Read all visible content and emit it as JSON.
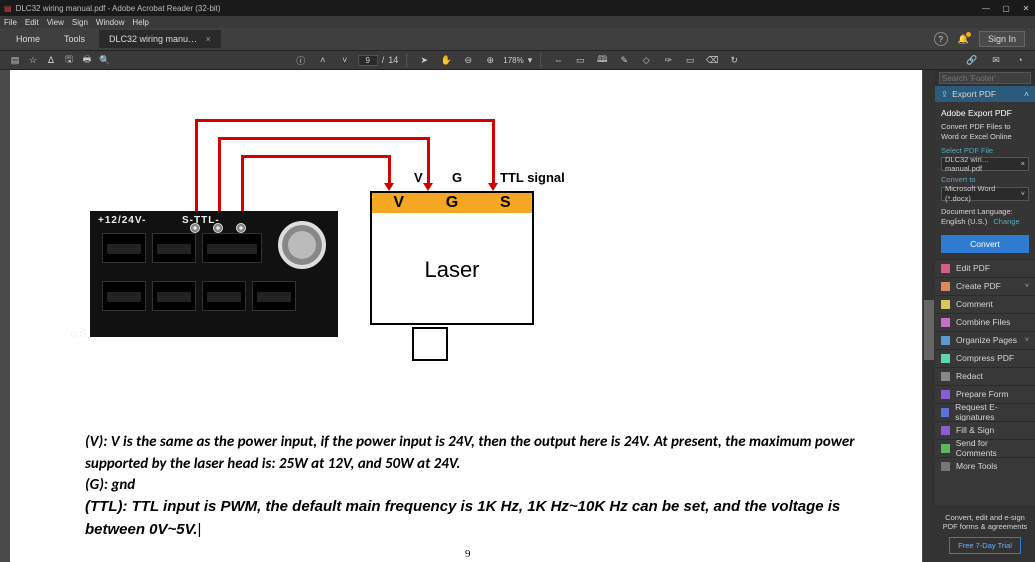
{
  "window": {
    "title": "DLC32 wiring manual.pdf - Adobe Acrobat Reader (32-bit)",
    "min": "—",
    "max": "▢",
    "close": "✕"
  },
  "menubar": [
    "File",
    "Edit",
    "View",
    "Sign",
    "Window",
    "Help"
  ],
  "tabs": {
    "home": "Home",
    "tools": "Tools",
    "doc": "DLC32 wiring manu…",
    "close": "×",
    "hint": "?",
    "bell": "🔔",
    "signin": "Sign In"
  },
  "toolbar": {
    "page_current": "9",
    "page_sep": "/",
    "page_total": "14",
    "zoom": "178%",
    "zoom_caret": "▾"
  },
  "rightpanel": {
    "search_placeholder": "Search 'Footer'",
    "export_header": "Export PDF",
    "export_title": "Adobe Export PDF",
    "export_desc": "Convert PDF Files to Word or Excel Online",
    "select_label": "Select PDF File",
    "selected_file": "DLC32 wiri…manual.pdf",
    "file_x": "×",
    "convert_to_label": "Convert to",
    "convert_to_value": "Microsoft Word (*.docx)",
    "doclang_label": "Document Language:",
    "doclang_value": "English (U.S.)",
    "doclang_change": "Change",
    "convert_btn": "Convert",
    "items": [
      "Edit PDF",
      "Create PDF",
      "Comment",
      "Combine Files",
      "Organize Pages",
      "Compress PDF",
      "Redact",
      "Prepare Form",
      "Request E-signatures",
      "Fill & Sign",
      "Send for Comments",
      "More Tools"
    ],
    "promo_text": "Convert, edit and e-sign PDF forms & agreements",
    "promo_btn": "Free 7-Day Trial"
  },
  "doc": {
    "labels": {
      "v": "V",
      "g": "G",
      "ttl": "TTL signal"
    },
    "pins": {
      "v": "V",
      "g": "G",
      "s": "S"
    },
    "laser": "Laser",
    "silk": "+12/24V-",
    "silk2": "S-TTL-",
    "side5v": "G  5V",
    "p1": "(V): V is the same as the power input, if the power input is 24V, then the output here is 24V. At present, the maximum power supported by the laser head is: 25W at 12V, and 50W at 24V.",
    "p2": "(G): gnd",
    "p3": "(TTL): TTL input is PWM, the default main frequency is 1K Hz, 1K Hz~10K Hz can be set, and the voltage is between 0V~5V.",
    "cursor": "|",
    "pagenum": "9"
  }
}
